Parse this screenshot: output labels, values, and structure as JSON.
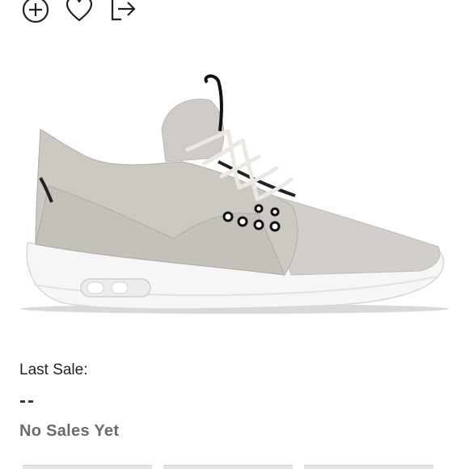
{
  "actions": {
    "icons": [
      "add-circle-icon",
      "heart-icon",
      "share-icon"
    ]
  },
  "product": {
    "image_alt": "sneaker-image"
  },
  "sales": {
    "last_sale_label": "Last Sale:",
    "last_sale_value": "--",
    "status_text": "No Sales Yet"
  },
  "colors": {
    "icon_stroke": "#222222",
    "status_text": "#6b6b6b"
  }
}
